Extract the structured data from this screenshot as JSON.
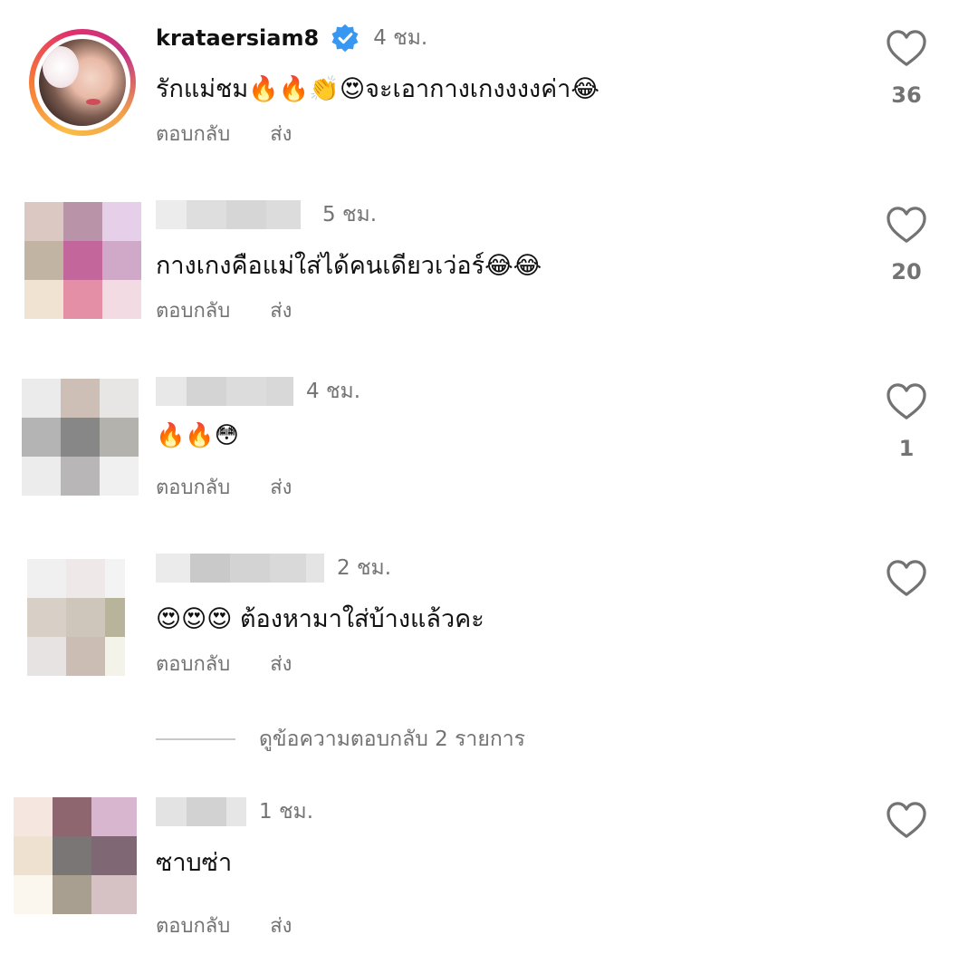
{
  "comments": [
    {
      "username": "krataersiam8",
      "verified": true,
      "time": "4 ชม.",
      "text": "รักแม่ชม🔥🔥👏😍จะเอากางเกงงงงค่า😂",
      "reply_label": "ตอบกลับ",
      "send_label": "ส่ง",
      "likes": "36"
    },
    {
      "username": "",
      "time": "5 ชม.",
      "text": "กางเกงคือแม่ใส่ได้คนเดียวเว่อร์😂😂",
      "reply_label": "ตอบกลับ",
      "send_label": "ส่ง",
      "likes": "20"
    },
    {
      "username": "",
      "time": "4 ชม.",
      "text": "🔥🔥😳",
      "reply_label": "ตอบกลับ",
      "send_label": "ส่ง",
      "likes": "1"
    },
    {
      "username": "",
      "time": "2 ชม.",
      "text": "😍😍😍 ต้องหามาใส่บ้างแล้วคะ",
      "reply_label": "ตอบกลับ",
      "send_label": "ส่ง",
      "likes": ""
    },
    {
      "username": "",
      "time": "1 ชม.",
      "text": "ซาบซ่า",
      "reply_label": "ตอบกลับ",
      "send_label": "ส่ง",
      "likes": ""
    }
  ],
  "view_replies": {
    "label": "ดูข้อความตอบกลับ 2 รายการ"
  },
  "icons": {
    "like": "heart-outline-icon",
    "verified": "verified-badge-icon"
  },
  "colors": {
    "verified_blue": "#3897f0",
    "secondary_text": "#737373",
    "primary_text": "#111111"
  }
}
